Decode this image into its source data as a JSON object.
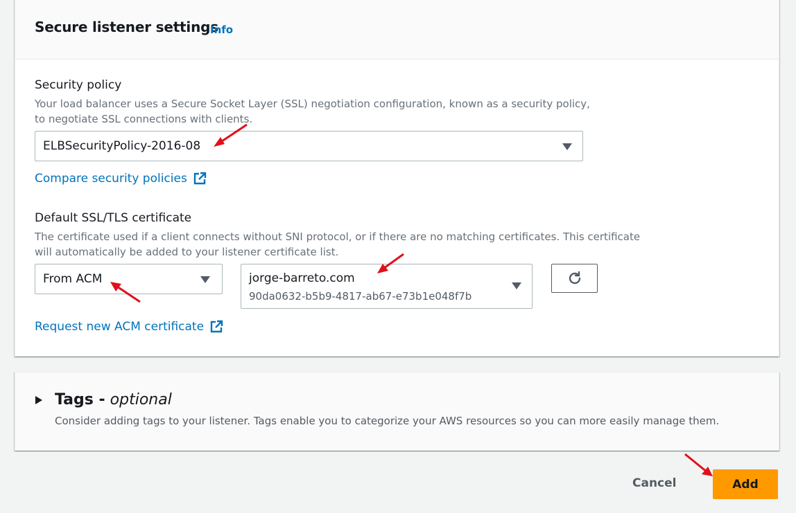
{
  "panel": {
    "title": "Secure listener settings",
    "info_label": "Info"
  },
  "security_policy": {
    "label": "Security policy",
    "description_line1": "Your load balancer uses a Secure Socket Layer (SSL) negotiation configuration, known as a security policy,",
    "description_line2": "to negotiate SSL connections with clients.",
    "selected": "ELBSecurityPolicy-2016-08",
    "compare_link": "Compare security policies"
  },
  "certificate": {
    "label": "Default SSL/TLS certificate",
    "description_line1": "The certificate used if a client connects without SNI protocol, or if there are no matching certificates. This certificate",
    "description_line2": "will automatically be added to your listener certificate list.",
    "source_selected": "From ACM",
    "cert_name": "jorge-barreto.com",
    "cert_id": "90da0632-b5b9-4817-ab67-e73b1e048f7b",
    "request_link": "Request new ACM certificate"
  },
  "tags": {
    "title_bold": "Tags -",
    "title_italic": "optional",
    "description": "Consider adding tags to your listener. Tags enable you to categorize your AWS resources so you can more easily manage them."
  },
  "footer": {
    "cancel_label": "Cancel",
    "add_label": "Add"
  },
  "colors": {
    "link": "#0073bb",
    "primary_button": "#ff9900",
    "annotation_arrow": "#e0101a"
  }
}
